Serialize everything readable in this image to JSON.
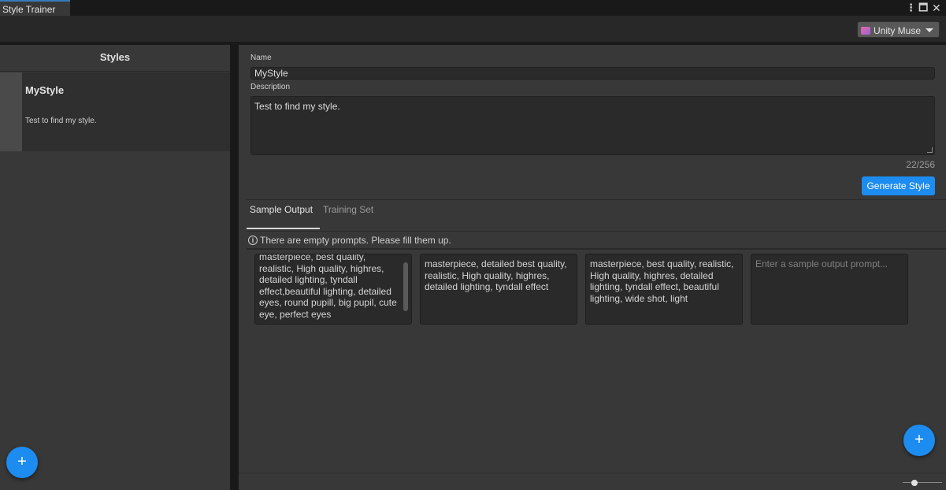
{
  "window": {
    "tab_title": "Style Trainer",
    "more_icon": "⋮",
    "maximize_icon": "🗖",
    "close_icon": "✕"
  },
  "toolbar": {
    "product_dropdown": "Unity Muse"
  },
  "styles_panel": {
    "header": "Styles",
    "items": [
      {
        "name": "MyStyle",
        "description": "Test to find my style."
      }
    ],
    "add_button": "+"
  },
  "form": {
    "name_label": "Name",
    "name_value": "MyStyle",
    "description_label": "Description",
    "description_value": "Test to find my style.",
    "char_count": "22/256",
    "generate_button": "Generate Style"
  },
  "tabs": [
    {
      "label": "Sample Output",
      "selected": true
    },
    {
      "label": "Training Set",
      "selected": false
    }
  ],
  "warning": {
    "icon": "i",
    "text": "There are empty prompts. Please fill them up."
  },
  "prompts": [
    {
      "value": "masterpiece, best quality, realistic, High quality, highres, detailed lighting, tyndall effect,beautiful lighting, detailed eyes, round pupill, big pupil, cute eye, perfect eyes"
    },
    {
      "value": "masterpiece, detailed best quality, realistic, High quality, highres, detailed lighting, tyndall effect"
    },
    {
      "value": "masterpiece, best quality, realistic, High quality, highres, detailed lighting, tyndall effect, beautiful lighting, wide shot, light"
    },
    {
      "value": "",
      "placeholder": "Enter a sample output prompt..."
    }
  ],
  "add_prompt_button": "+",
  "zoom_level": 0.25
}
